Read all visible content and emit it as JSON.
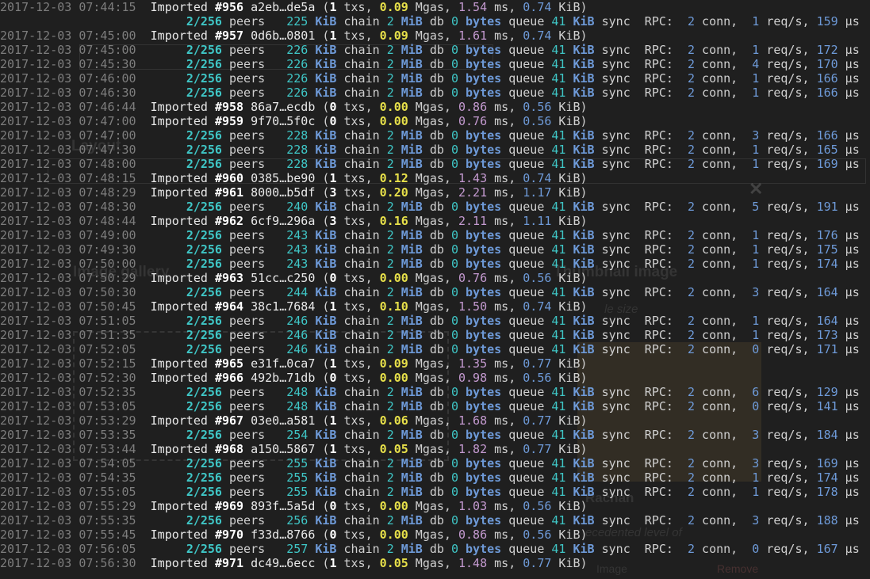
{
  "log_lines": [
    {
      "ts": "2017-12-03 07:44:15",
      "type": "import",
      "block": "#956",
      "hash": "a2eb…de5a",
      "txs": "1",
      "mgas": "0.09",
      "ms": "1.54",
      "kib": "0.74"
    },
    {
      "ts": "",
      "type": "sync",
      "peers": "2/256",
      "mem": "225",
      "chain": "2",
      "db": "0",
      "queue": "41",
      "conn": "2",
      "req": "1",
      "us": "159"
    },
    {
      "ts": "2017-12-03 07:45:00",
      "type": "import",
      "block": "#957",
      "hash": "0d6b…0801",
      "txs": "1",
      "mgas": "0.09",
      "ms": "1.61",
      "kib": "0.74"
    },
    {
      "ts": "2017-12-03 07:45:00",
      "type": "sync",
      "peers": "2/256",
      "mem": "226",
      "chain": "2",
      "db": "0",
      "queue": "41",
      "conn": "2",
      "req": "1",
      "us": "172"
    },
    {
      "ts": "2017-12-03 07:45:30",
      "type": "sync",
      "peers": "2/256",
      "mem": "226",
      "chain": "2",
      "db": "0",
      "queue": "41",
      "conn": "2",
      "req": "4",
      "us": "170"
    },
    {
      "ts": "2017-12-03 07:46:00",
      "type": "sync",
      "peers": "2/256",
      "mem": "226",
      "chain": "2",
      "db": "0",
      "queue": "41",
      "conn": "2",
      "req": "1",
      "us": "166"
    },
    {
      "ts": "2017-12-03 07:46:30",
      "type": "sync",
      "peers": "2/256",
      "mem": "226",
      "chain": "2",
      "db": "0",
      "queue": "41",
      "conn": "2",
      "req": "1",
      "us": "166"
    },
    {
      "ts": "2017-12-03 07:46:44",
      "type": "import",
      "block": "#958",
      "hash": "86a7…ecdb",
      "txs": "0",
      "mgas": "0.00",
      "ms": "0.86",
      "kib": "0.56"
    },
    {
      "ts": "2017-12-03 07:47:00",
      "type": "import",
      "block": "#959",
      "hash": "9f70…5f0c",
      "txs": "0",
      "mgas": "0.00",
      "ms": "0.76",
      "kib": "0.56"
    },
    {
      "ts": "2017-12-03 07:47:00",
      "type": "sync",
      "peers": "2/256",
      "mem": "228",
      "chain": "2",
      "db": "0",
      "queue": "41",
      "conn": "2",
      "req": "3",
      "us": "166"
    },
    {
      "ts": "2017-12-03 07:47:30",
      "type": "sync",
      "peers": "2/256",
      "mem": "228",
      "chain": "2",
      "db": "0",
      "queue": "41",
      "conn": "2",
      "req": "1",
      "us": "165"
    },
    {
      "ts": "2017-12-03 07:48:00",
      "type": "sync",
      "peers": "2/256",
      "mem": "228",
      "chain": "2",
      "db": "0",
      "queue": "41",
      "conn": "2",
      "req": "1",
      "us": "169"
    },
    {
      "ts": "2017-12-03 07:48:15",
      "type": "import",
      "block": "#960",
      "hash": "0385…be90",
      "txs": "1",
      "mgas": "0.12",
      "ms": "1.43",
      "kib": "0.74"
    },
    {
      "ts": "2017-12-03 07:48:29",
      "type": "import",
      "block": "#961",
      "hash": "8000…b5df",
      "txs": "3",
      "mgas": "0.20",
      "ms": "2.21",
      "kib": "1.17"
    },
    {
      "ts": "2017-12-03 07:48:30",
      "type": "sync",
      "peers": "2/256",
      "mem": "240",
      "chain": "2",
      "db": "0",
      "queue": "41",
      "conn": "2",
      "req": "5",
      "us": "191"
    },
    {
      "ts": "2017-12-03 07:48:44",
      "type": "import",
      "block": "#962",
      "hash": "6cf9…296a",
      "txs": "3",
      "mgas": "0.16",
      "ms": "2.11",
      "kib": "1.11"
    },
    {
      "ts": "2017-12-03 07:49:00",
      "type": "sync",
      "peers": "2/256",
      "mem": "243",
      "chain": "2",
      "db": "0",
      "queue": "41",
      "conn": "2",
      "req": "1",
      "us": "176"
    },
    {
      "ts": "2017-12-03 07:49:30",
      "type": "sync",
      "peers": "2/256",
      "mem": "243",
      "chain": "2",
      "db": "0",
      "queue": "41",
      "conn": "2",
      "req": "1",
      "us": "175"
    },
    {
      "ts": "2017-12-03 07:50:00",
      "type": "sync",
      "peers": "2/256",
      "mem": "243",
      "chain": "2",
      "db": "0",
      "queue": "41",
      "conn": "2",
      "req": "1",
      "us": "174"
    },
    {
      "ts": "2017-12-03 07:50:29",
      "type": "import",
      "block": "#963",
      "hash": "51cc…c250",
      "txs": "0",
      "mgas": "0.00",
      "ms": "0.76",
      "kib": "0.56"
    },
    {
      "ts": "2017-12-03 07:50:30",
      "type": "sync",
      "peers": "2/256",
      "mem": "244",
      "chain": "2",
      "db": "0",
      "queue": "41",
      "conn": "2",
      "req": "3",
      "us": "164"
    },
    {
      "ts": "2017-12-03 07:50:45",
      "type": "import",
      "block": "#964",
      "hash": "38c1…7684",
      "txs": "1",
      "mgas": "0.10",
      "ms": "1.50",
      "kib": "0.74"
    },
    {
      "ts": "2017-12-03 07:51:05",
      "type": "sync",
      "peers": "2/256",
      "mem": "246",
      "chain": "2",
      "db": "0",
      "queue": "41",
      "conn": "2",
      "req": "1",
      "us": "164"
    },
    {
      "ts": "2017-12-03 07:51:35",
      "type": "sync",
      "peers": "2/256",
      "mem": "246",
      "chain": "2",
      "db": "0",
      "queue": "41",
      "conn": "2",
      "req": "1",
      "us": "173"
    },
    {
      "ts": "2017-12-03 07:52:05",
      "type": "sync",
      "peers": "2/256",
      "mem": "246",
      "chain": "2",
      "db": "0",
      "queue": "41",
      "conn": "2",
      "req": "0",
      "us": "171"
    },
    {
      "ts": "2017-12-03 07:52:15",
      "type": "import",
      "block": "#965",
      "hash": "e31f…0ca7",
      "txs": "1",
      "mgas": "0.09",
      "ms": "1.35",
      "kib": "0.77"
    },
    {
      "ts": "2017-12-03 07:52:30",
      "type": "import",
      "block": "#966",
      "hash": "492b…71db",
      "txs": "0",
      "mgas": "0.00",
      "ms": "0.98",
      "kib": "0.56"
    },
    {
      "ts": "2017-12-03 07:52:35",
      "type": "sync",
      "peers": "2/256",
      "mem": "248",
      "chain": "2",
      "db": "0",
      "queue": "41",
      "conn": "2",
      "req": "6",
      "us": "129"
    },
    {
      "ts": "2017-12-03 07:53:05",
      "type": "sync",
      "peers": "2/256",
      "mem": "248",
      "chain": "2",
      "db": "0",
      "queue": "41",
      "conn": "2",
      "req": "0",
      "us": "141"
    },
    {
      "ts": "2017-12-03 07:53:29",
      "type": "import",
      "block": "#967",
      "hash": "03e0…a581",
      "txs": "1",
      "mgas": "0.06",
      "ms": "1.68",
      "kib": "0.77"
    },
    {
      "ts": "2017-12-03 07:53:35",
      "type": "sync",
      "peers": "2/256",
      "mem": "254",
      "chain": "2",
      "db": "0",
      "queue": "41",
      "conn": "2",
      "req": "3",
      "us": "184"
    },
    {
      "ts": "2017-12-03 07:53:44",
      "type": "import",
      "block": "#968",
      "hash": "a150…5867",
      "txs": "1",
      "mgas": "0.05",
      "ms": "1.82",
      "kib": "0.77"
    },
    {
      "ts": "2017-12-03 07:54:05",
      "type": "sync",
      "peers": "2/256",
      "mem": "255",
      "chain": "2",
      "db": "0",
      "queue": "41",
      "conn": "2",
      "req": "3",
      "us": "169"
    },
    {
      "ts": "2017-12-03 07:54:35",
      "type": "sync",
      "peers": "2/256",
      "mem": "255",
      "chain": "2",
      "db": "0",
      "queue": "41",
      "conn": "2",
      "req": "1",
      "us": "174"
    },
    {
      "ts": "2017-12-03 07:55:05",
      "type": "sync",
      "peers": "2/256",
      "mem": "255",
      "chain": "2",
      "db": "0",
      "queue": "41",
      "conn": "2",
      "req": "1",
      "us": "178"
    },
    {
      "ts": "2017-12-03 07:55:29",
      "type": "import",
      "block": "#969",
      "hash": "893f…5a5d",
      "txs": "0",
      "mgas": "0.00",
      "ms": "1.03",
      "kib": "0.56"
    },
    {
      "ts": "2017-12-03 07:55:35",
      "type": "sync",
      "peers": "2/256",
      "mem": "256",
      "chain": "2",
      "db": "0",
      "queue": "41",
      "conn": "2",
      "req": "3",
      "us": "188"
    },
    {
      "ts": "2017-12-03 07:55:45",
      "type": "import",
      "block": "#970",
      "hash": "f33d…8766",
      "txs": "0",
      "mgas": "0.00",
      "ms": "0.86",
      "kib": "0.56"
    },
    {
      "ts": "2017-12-03 07:56:05",
      "type": "sync",
      "peers": "2/256",
      "mem": "257",
      "chain": "2",
      "db": "0",
      "queue": "41",
      "conn": "2",
      "req": "0",
      "us": "167"
    },
    {
      "ts": "2017-12-03 07:56:30",
      "type": "import",
      "block": "#971",
      "hash": "dc49…6ecc",
      "txs": "1",
      "mgas": "0.05",
      "ms": "1.48",
      "kib": "0.77"
    }
  ],
  "ghost": {
    "title_left": "Layout",
    "title_gallery": "Image gallery",
    "title_thumb": "Thumbnail image",
    "title_sub": "Rachan",
    "thumb_text": "le size",
    "link_remove": "Remove",
    "btn_image": "Image",
    "caption": "ecedented level of"
  },
  "colors": {
    "background": "#1f1f1f",
    "timestamp": "#7d7d7d",
    "cyan": "#3fc6c6",
    "blue": "#6e9ad8",
    "yellow": "#e7e04a",
    "magenta": "#c49ad0"
  }
}
